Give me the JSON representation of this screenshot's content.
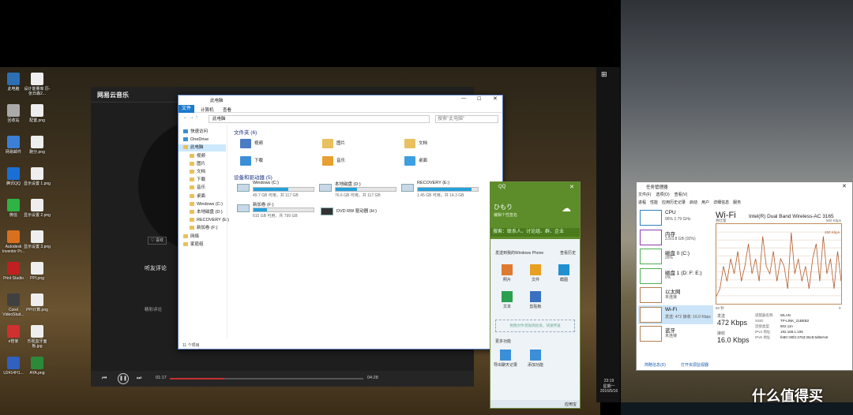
{
  "desktop_icons": [
    {
      "label": "此电脑",
      "color": "#2c6fb5"
    },
    {
      "label": "设计能量库 历-张日森2...",
      "color": "#eee"
    },
    {
      "label": "回收站",
      "color": "#aaa"
    },
    {
      "label": "配置.png",
      "color": "#eee"
    },
    {
      "label": "网易邮件",
      "color": "#3b7fd6"
    },
    {
      "label": "跑分.png",
      "color": "#eee"
    },
    {
      "label": "腾讯QQ",
      "color": "#1a6fd6"
    },
    {
      "label": "显示设置 1.png",
      "color": "#eee"
    },
    {
      "label": "微信",
      "color": "#2fb344"
    },
    {
      "label": "显示设置 2.png",
      "color": "#eee"
    },
    {
      "label": "Autodesk Inventor Pr...",
      "color": "#d87020"
    },
    {
      "label": "显示设置 3.png",
      "color": "#eee"
    },
    {
      "label": "Print Studio",
      "color": "#c02020"
    },
    {
      "label": "PPI.png",
      "color": "#eee"
    },
    {
      "label": "Corel VideoStud...",
      "color": "#404040"
    },
    {
      "label": "PPI计算.png",
      "color": "#eee"
    },
    {
      "label": "e管家",
      "color": "#d03030"
    },
    {
      "label": "乐视监牙面 板.jpg",
      "color": "#eee"
    },
    {
      "label": "U2414H1...",
      "color": "#3060c0"
    },
    {
      "label": "AYA.png",
      "color": "#2a8a3a"
    }
  ],
  "netease": {
    "title": "网易云音乐",
    "comments_heading": "听友评论",
    "hot_label": "精彩评论",
    "time_current": "01:17",
    "time_total": "04:28",
    "progress": 0.28,
    "fav": "♡ 喜欢"
  },
  "explorer": {
    "title": "此电脑",
    "tabs": [
      "文件",
      "计算机",
      "查看"
    ],
    "address": "此电脑",
    "search_placeholder": "搜索\"此电脑\"",
    "nav": [
      "快速访问",
      "OneDrive",
      "此电脑",
      "视频",
      "图片",
      "文档",
      "下载",
      "音乐",
      "桌面",
      "Windows (C:)",
      "本地磁盘 (D:)",
      "RECOVERY (E:)",
      "新加卷 (F:)",
      "网络",
      "家庭组"
    ],
    "folders_header": "文件夹 (6)",
    "folders": [
      {
        "name": "视频",
        "color": "#4a7bc4"
      },
      {
        "name": "图片",
        "color": "#e8c060"
      },
      {
        "name": "文档",
        "color": "#e8c060"
      },
      {
        "name": "下载",
        "color": "#3b8fd8"
      },
      {
        "name": "音乐",
        "color": "#e8a030"
      },
      {
        "name": "桌面",
        "color": "#3b9fe0"
      }
    ],
    "drives_header": "设备和驱动器 (5)",
    "drives": [
      {
        "name": "Windows (C:)",
        "free": "49.7 GB 可用，共 117 GB",
        "used": 0.58
      },
      {
        "name": "本地磁盘 (D:)",
        "free": "76.6 GB 可用，共 117 GB",
        "used": 0.35
      },
      {
        "name": "RECOVERY (E:)",
        "free": "1.45 GB 可用，共 14.3 GB",
        "used": 0.9
      },
      {
        "name": "新加卷 (F:)",
        "free": "615 GB 可用，共 799 GB",
        "used": 0.23
      }
    ],
    "dvd": "DVD RW 驱动器 (H:)",
    "status": "11 个项目"
  },
  "qq": {
    "title": "QQ",
    "nick": "ひもり",
    "sign": "编辑个性签名",
    "search": "搜索：联系人、讨论组、群、企业",
    "device": "发送到我的Windows Phone",
    "history": "查看历史",
    "apps": [
      "照片",
      "文件",
      "截图",
      "文本",
      "剪贴板"
    ],
    "drop_tip": "拖拽文件/剪贴到此处，快速传送",
    "more": "更多功能",
    "bottom_apps": [
      "导出聊天记录",
      "添加功能"
    ],
    "app_store": "应用宝"
  },
  "taskmgr": {
    "title": "任务管理器",
    "menu": [
      "文件(F)",
      "选项(O)",
      "查看(V)"
    ],
    "tabs": [
      "进程",
      "性能",
      "应用历史记录",
      "启动",
      "用户",
      "详细信息",
      "服务"
    ],
    "list": [
      {
        "name": "CPU",
        "sub": "96% 2.79 GHz"
      },
      {
        "name": "内存",
        "sub": "3.5/3.8 GB (92%)"
      },
      {
        "name": "磁盘 0 (C:)",
        "sub": "26%"
      },
      {
        "name": "磁盘 1 (D: F: E:)",
        "sub": "0%"
      },
      {
        "name": "以太网",
        "sub": "未连接"
      },
      {
        "name": "Wi-Fi",
        "sub": "发送: 472 接收: 16.0 Kbps"
      },
      {
        "name": "蓝牙",
        "sub": "未连接"
      }
    ],
    "heading": "Wi-Fi",
    "adapter": "Intel(R) Dual Band Wireless-AC 3165",
    "graph_label": "吞吐量",
    "graph_max": "500 Kbps",
    "graph_mark": "450 Kbps",
    "graph_left": "60 秒",
    "graph_right": "0",
    "send_label": "发送",
    "send": "472 Kbps",
    "recv_label": "接收",
    "recv": "16.0 Kbps",
    "details": [
      [
        "适配器名称",
        "WLAN"
      ],
      [
        "SSID",
        "TP-LINK_21BEB2"
      ],
      [
        "连接类型",
        "802.11n"
      ],
      [
        "IPv4 地址",
        "192.168.1.105"
      ],
      [
        "IPv6 地址",
        "fe80::90f2:4763:25c8:6d8e%8"
      ]
    ],
    "brief": "简略信息(D)",
    "open_monitor": "打开资源监视器",
    "series": [
      0.1,
      0.2,
      0.5,
      0.3,
      0.6,
      0.4,
      0.7,
      0.3,
      0.5,
      0.8,
      0.4,
      0.6,
      0.3,
      0.9,
      0.5,
      0.4,
      0.7,
      0.3,
      0.6,
      0.5,
      0.2,
      0.95,
      0.4,
      0.6,
      0.3,
      0.5,
      0.2,
      0.6,
      0.8,
      0.3,
      0.9,
      0.4,
      0.6,
      0.2,
      0.7,
      0.3
    ]
  },
  "clock": {
    "time": "23:19",
    "day": "星期一",
    "date": "2016/5/16"
  },
  "watermark": "什么值得买"
}
